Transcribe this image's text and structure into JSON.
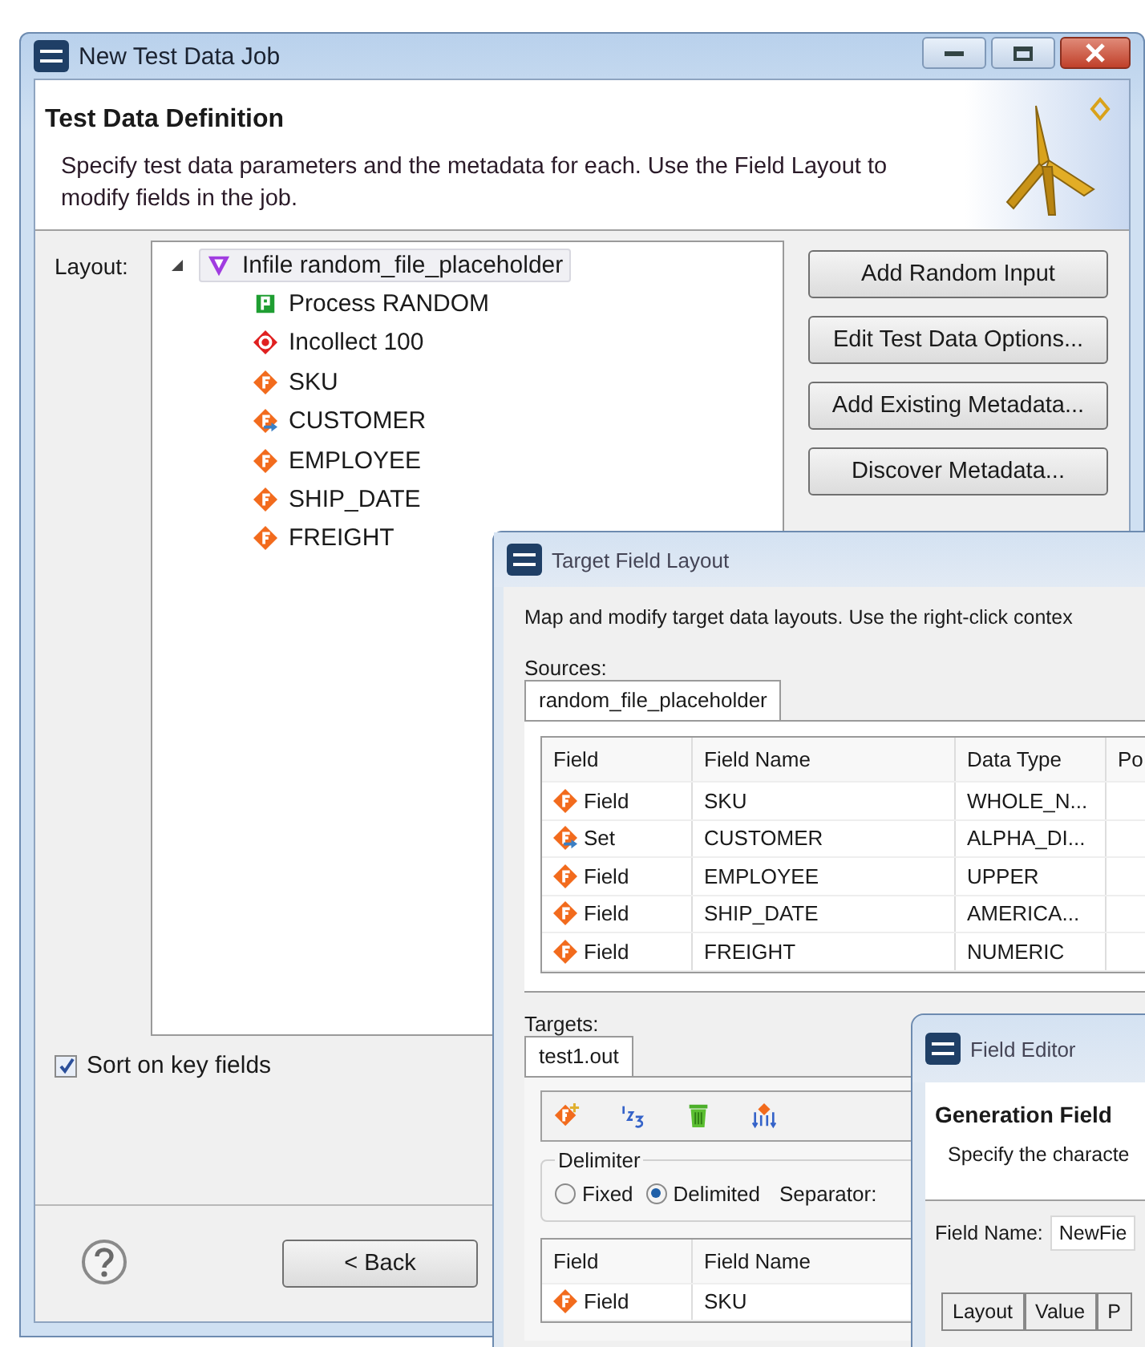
{
  "main_window": {
    "title": "New Test Data Job",
    "header": {
      "title": "Test Data Definition",
      "description": "Specify test data parameters and the metadata for each. Use the Field Layout to modify fields in the job."
    },
    "layout_label": "Layout:",
    "tree": [
      {
        "label": "Infile random_file_placeholder",
        "kind": "infile",
        "expanded": true,
        "selected": true,
        "children": [
          {
            "label": "Process RANDOM",
            "kind": "process",
            "selected": false
          },
          {
            "label": "Incollect 100",
            "kind": "collect",
            "selected": false
          },
          {
            "label": "SKU",
            "kind": "field",
            "selected": false
          },
          {
            "label": "CUSTOMER",
            "kind": "set",
            "selected": false
          },
          {
            "label": "EMPLOYEE",
            "kind": "field",
            "selected": false
          },
          {
            "label": "SHIP_DATE",
            "kind": "field",
            "selected": false
          },
          {
            "label": "FREIGHT",
            "kind": "field",
            "selected": false
          }
        ]
      }
    ],
    "buttons": [
      "Add Random Input",
      "Edit Test Data Options...",
      "Add Existing Metadata...",
      "Discover Metadata..."
    ],
    "sort_checkbox": {
      "label": "Sort on key fields",
      "checked": true
    },
    "back_button": "< Back"
  },
  "target_window": {
    "title": "Target Field Layout",
    "description": "Map and modify target data layouts. Use the right-click contex",
    "sources_label": "Sources:",
    "source_tabs": [
      {
        "label": "random_file_placeholder",
        "selected": true
      }
    ],
    "source_table": {
      "columns": [
        "Field",
        "Field Name",
        "Data Type",
        "Po"
      ],
      "rows": [
        {
          "kind": "field",
          "cells": [
            "Field",
            "SKU",
            "WHOLE_N..."
          ]
        },
        {
          "kind": "set",
          "cells": [
            "Set",
            "CUSTOMER",
            "ALPHA_DI..."
          ]
        },
        {
          "kind": "field",
          "cells": [
            "Field",
            "EMPLOYEE",
            "UPPER"
          ]
        },
        {
          "kind": "field",
          "cells": [
            "Field",
            "SHIP_DATE",
            "AMERICA..."
          ]
        },
        {
          "kind": "field",
          "cells": [
            "Field",
            "FREIGHT",
            "NUMERIC"
          ]
        }
      ]
    },
    "targets_label": "Targets:",
    "target_tabs": [
      {
        "label": "test1.out",
        "selected": true
      }
    ],
    "delimiter": {
      "label": "Delimiter",
      "options": [
        {
          "label": "Fixed",
          "selected": false
        },
        {
          "label": "Delimited",
          "selected": true
        }
      ],
      "separator_label": "Separator:"
    },
    "target_table": {
      "columns": [
        "Field",
        "Field Name"
      ],
      "rows": [
        {
          "kind": "field",
          "cells": [
            "Field",
            "SKU"
          ]
        }
      ]
    }
  },
  "field_editor": {
    "title": "Field Editor",
    "header_title": "Generation Field",
    "description": "Specify the characte",
    "field_name_label": "Field Name:",
    "field_name_value": "NewFie",
    "columns": [
      "Layout",
      "Value",
      "P"
    ]
  }
}
